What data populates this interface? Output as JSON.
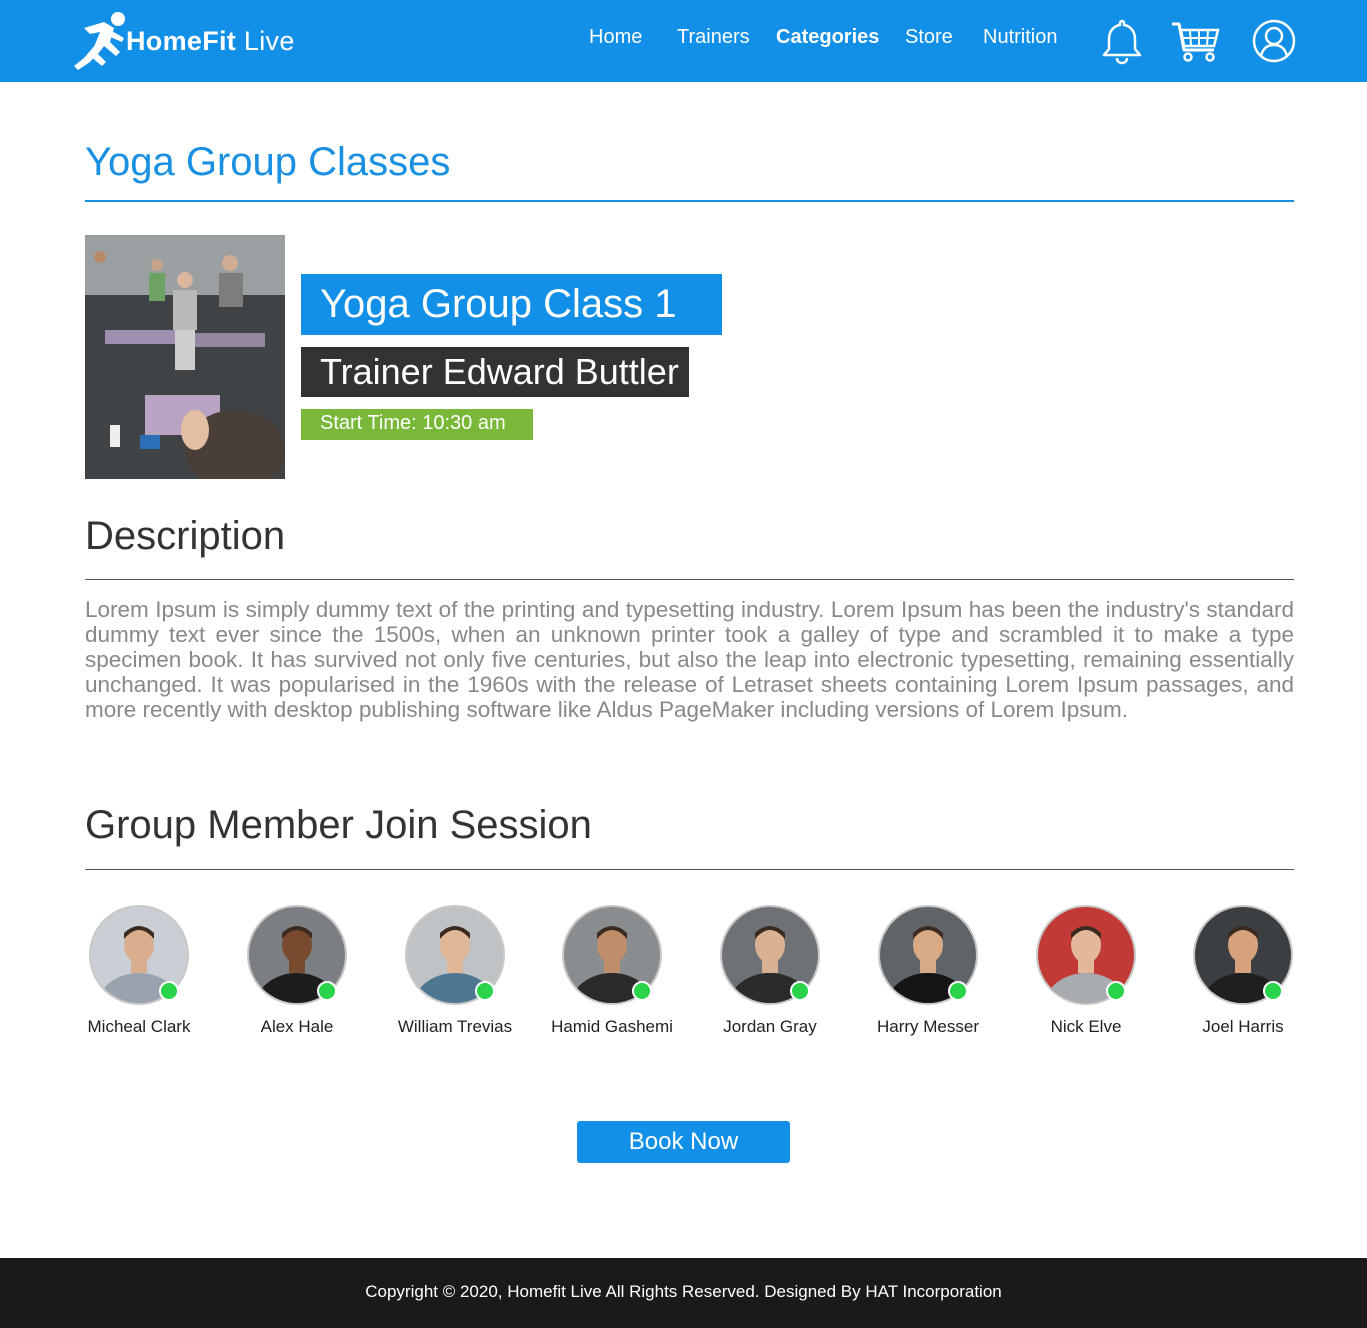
{
  "header": {
    "brand_bold": "HomeFit",
    "brand_light": "Live",
    "nav": [
      {
        "label": "Home",
        "active": false
      },
      {
        "label": "Trainers",
        "active": false
      },
      {
        "label": "Categories",
        "active": true
      },
      {
        "label": "Store",
        "active": false
      },
      {
        "label": "Nutrition",
        "active": false
      }
    ],
    "icons": [
      "bell-icon",
      "cart-icon",
      "user-profile-icon"
    ],
    "accent_color": "#128fe6"
  },
  "page": {
    "title": "Yoga Group Classes"
  },
  "class_card": {
    "image": "yoga-class-photo",
    "name": "Yoga Group Class 1",
    "trainer": "Trainer Edward Buttler",
    "start_time": "Start Time: 10:30 am",
    "badge_colors": {
      "name": "#128fe6",
      "trainer": "#333333",
      "time": "#7ab83a"
    }
  },
  "description": {
    "heading": "Description",
    "text": "Lorem Ipsum is simply dummy text of the printing and typesetting industry. Lorem Ipsum has been the industry's standard dummy text ever since the 1500s, when an unknown printer took a galley of type and scrambled it to make a type specimen book. It has survived not only five centuries, but also the leap into electronic typesetting, remaining essentially unchanged. It was popularised in the 1960s with the release of Letraset sheets containing Lorem Ipsum passages, and more recently with desktop publishing software like Aldus PageMaker including versions of Lorem Ipsum."
  },
  "members": {
    "heading": "Group Member Join Session",
    "online_color": "#29d44a",
    "list": [
      {
        "name": "Micheal Clark",
        "online": true
      },
      {
        "name": "Alex Hale",
        "online": true
      },
      {
        "name": "William Trevias",
        "online": true
      },
      {
        "name": "Hamid Gashemi",
        "online": true
      },
      {
        "name": "Jordan Gray",
        "online": true
      },
      {
        "name": "Harry Messer",
        "online": true
      },
      {
        "name": "Nick Elve",
        "online": true
      },
      {
        "name": "Joel Harris",
        "online": true
      }
    ]
  },
  "actions": {
    "book_label": "Book Now"
  },
  "footer": {
    "copyright": "Copyright © 2020, Homefit Live All Rights Reserved. Designed By HAT Incorporation"
  }
}
